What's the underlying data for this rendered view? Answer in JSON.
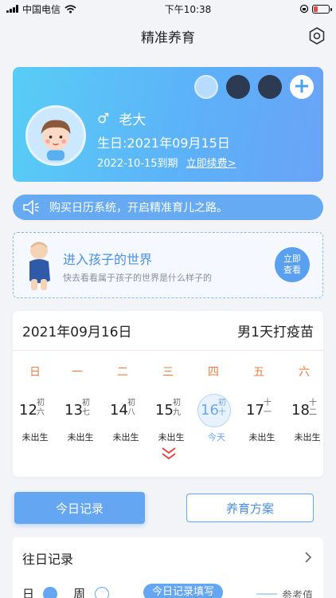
{
  "status_bar": {
    "carrier": "中国电信",
    "time": "下午10:38"
  },
  "nav": {
    "title": "精准养育"
  },
  "profile": {
    "gender_symbol": "♂",
    "name": "老大",
    "birthday": "生日:2021年09月15日",
    "expire_date": "2022-10-15到期",
    "renew_label": "立即续费>"
  },
  "promo": {
    "text": "购买日历系统，开启精准育儿之路。"
  },
  "world": {
    "title": "进入孩子的世界",
    "subtitle": "快去看看属于孩子的世界是什么样子的",
    "button_line1": "立即",
    "button_line2": "查看"
  },
  "calendar": {
    "date": "2021年09月16日",
    "note": "男1天打疫苗",
    "weekdays": [
      "日",
      "一",
      "二",
      "三",
      "四",
      "五",
      "六"
    ],
    "days": [
      {
        "num": "12",
        "lunar_top": "初",
        "lunar_bottom": "六",
        "status": "未出生"
      },
      {
        "num": "13",
        "lunar_top": "初",
        "lunar_bottom": "七",
        "status": "未出生"
      },
      {
        "num": "14",
        "lunar_top": "初",
        "lunar_bottom": "八",
        "status": "未出生"
      },
      {
        "num": "15",
        "lunar_top": "初",
        "lunar_bottom": "九",
        "status": "未出生"
      },
      {
        "num": "16",
        "lunar_top": "初",
        "lunar_bottom": "十",
        "status": "今天"
      },
      {
        "num": "17",
        "lunar_top": "十",
        "lunar_bottom": "一",
        "status": "未出生"
      },
      {
        "num": "18",
        "lunar_top": "十",
        "lunar_bottom": "二",
        "status": "未出生"
      }
    ]
  },
  "actions": {
    "today_record": "今日记录",
    "plan": "养育方案"
  },
  "history": {
    "title": "往日记录",
    "day_label": "日",
    "week_label": "周",
    "fill_button": "今日记录填写",
    "legend": "参考值"
  },
  "colors": {
    "accent": "#64a6f2",
    "weekday": "#ea7d45",
    "card_gradient_start": "#58cdf6",
    "card_gradient_end": "#6aa3f7"
  }
}
